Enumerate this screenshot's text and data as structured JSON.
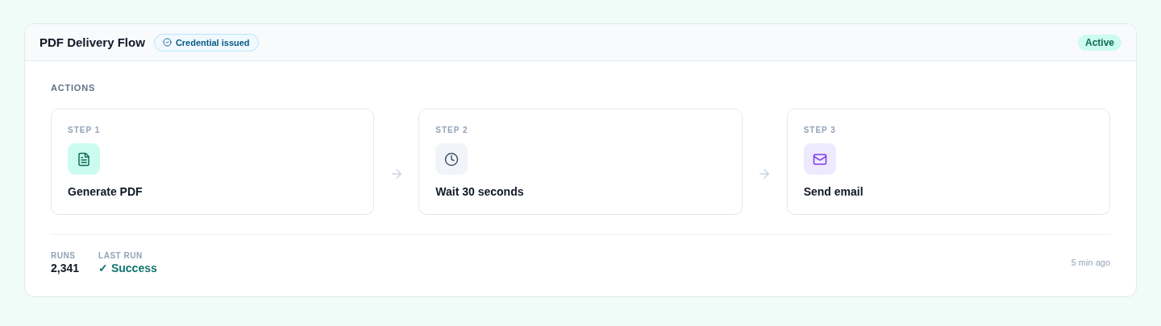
{
  "flow": {
    "title": "PDF Delivery Flow",
    "credential_badge": "Credential issued",
    "status": "Active"
  },
  "actions": {
    "heading": "ACTIONS",
    "steps": [
      {
        "label": "STEP 1",
        "title": "Generate PDF",
        "kind": "document"
      },
      {
        "label": "STEP 2",
        "title": "Wait 30 seconds",
        "kind": "clock"
      },
      {
        "label": "STEP 3",
        "title": "Send email",
        "kind": "mail"
      }
    ]
  },
  "footer": {
    "runs_label": "RUNS",
    "runs_value": "2,341",
    "last_run_label": "LAST RUN",
    "last_run_value": "✓ Success",
    "last_run_succeeded": true,
    "time_ago": "5 min ago"
  }
}
